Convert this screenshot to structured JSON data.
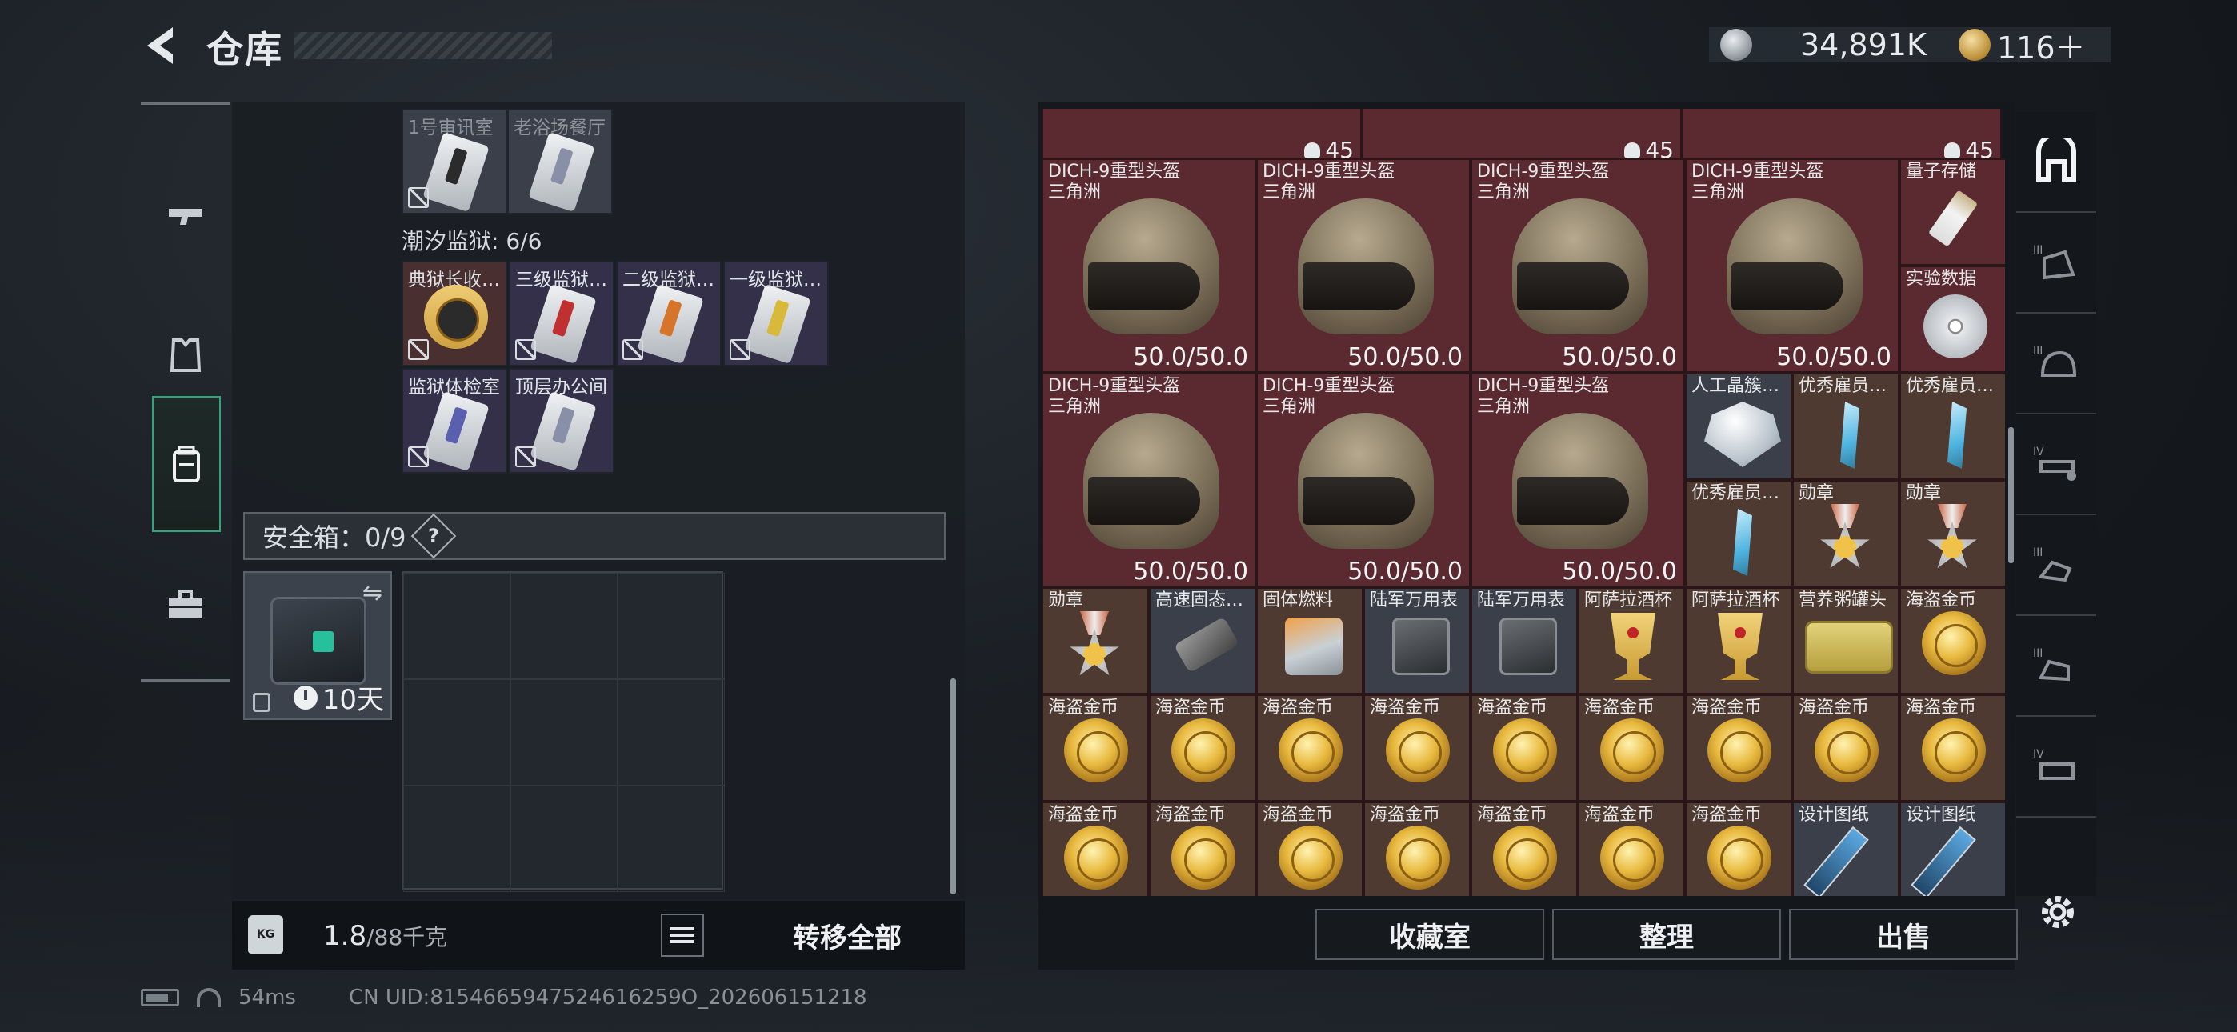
{
  "header": {
    "title": "仓库",
    "currency1": "34,891K",
    "currency2": "116＋"
  },
  "left_tabs": [
    {
      "icon": "pistol-icon"
    },
    {
      "icon": "armor-vest-icon"
    },
    {
      "icon": "backpack-icon"
    },
    {
      "icon": "toolbox-icon"
    }
  ],
  "keys_top": [
    {
      "label": "1号审讯室",
      "dim": true
    },
    {
      "label": "老浴场餐厅",
      "dim": true
    }
  ],
  "prison_label": "潮汐监狱: 6/6",
  "keys_prison": [
    {
      "label": "典狱长收…"
    },
    {
      "label": "三级监狱…"
    },
    {
      "label": "二级监狱…"
    },
    {
      "label": "一级监狱…"
    },
    {
      "label": "监狱体检室"
    },
    {
      "label": "顶层办公间"
    }
  ],
  "safe": {
    "label": "安全箱：0/9",
    "help": "?",
    "days": "10天"
  },
  "weight": {
    "current": "1.8",
    "capacity": "/88千克",
    "kg_label": "KG",
    "transfer": "转移全部"
  },
  "stash_top_counts": [
    "45",
    "45",
    "45"
  ],
  "helmets": [
    {
      "name": "DICH-9重型头盔",
      "sub": "三角洲",
      "dur": "50.0/50.0"
    },
    {
      "name": "DICH-9重型头盔",
      "sub": "三角洲",
      "dur": "50.0/50.0"
    },
    {
      "name": "DICH-9重型头盔",
      "sub": "三角洲",
      "dur": "50.0/50.0"
    },
    {
      "name": "DICH-9重型头盔",
      "sub": "三角洲",
      "dur": "50.0/50.0"
    },
    {
      "name": "DICH-9重型头盔",
      "sub": "三角洲",
      "dur": "50.0/50.0"
    },
    {
      "name": "DICH-9重型头盔",
      "sub": "三角洲",
      "dur": "50.0/50.0"
    },
    {
      "name": "DICH-9重型头盔",
      "sub": "三角洲",
      "dur": "50.0/50.0"
    }
  ],
  "small_items": {
    "quantum": "量子存储",
    "data": "实验数据",
    "diamond": "人工晶簇…",
    "emp1": "优秀雇员…",
    "emp2": "优秀雇员…",
    "emp3": "优秀雇员…",
    "medal1": "勋章",
    "medal2": "勋章"
  },
  "row3": [
    "勋章",
    "高速固态…",
    "固体燃料",
    "陆军万用表",
    "陆军万用表",
    "阿萨拉酒杯",
    "阿萨拉酒杯",
    "营养粥罐头",
    "海盗金币"
  ],
  "row4": [
    "海盗金币",
    "海盗金币",
    "海盗金币",
    "海盗金币",
    "海盗金币",
    "海盗金币",
    "海盗金币",
    "海盗金币",
    "海盗金币"
  ],
  "row5": [
    "海盗金币",
    "海盗金币",
    "海盗金币",
    "海盗金币",
    "海盗金币",
    "海盗金币",
    "海盗金币",
    "设计图纸",
    "设计图纸"
  ],
  "right_tabs": [
    "stash-all-icon",
    "tier3-cap-icon",
    "tier3-helmet-icon",
    "tier4-gun-icon",
    "tier3-hand-icon",
    "tier3-glove-icon",
    "tier4-crate-icon"
  ],
  "buttons": {
    "collection": "收藏室",
    "organize": "整理",
    "sell": "出售"
  },
  "status": {
    "ping": "54ms",
    "uid": "CN UID:8154665947524616259O_202606151218"
  }
}
